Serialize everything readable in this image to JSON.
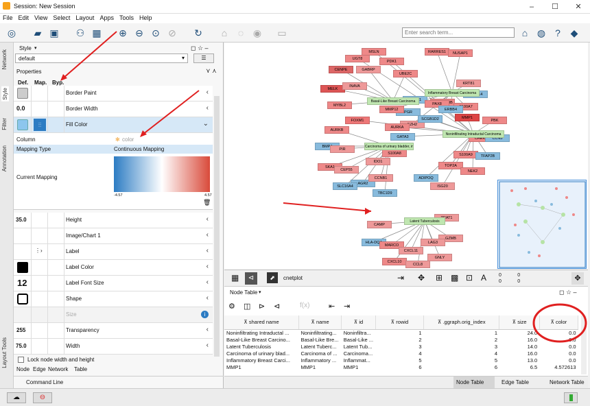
{
  "window": {
    "title": "Session: New Session"
  },
  "menu": [
    "File",
    "Edit",
    "View",
    "Select",
    "Layout",
    "Apps",
    "Tools",
    "Help"
  ],
  "search": {
    "placeholder": "Enter search term..."
  },
  "sidetabs": [
    "Network",
    "Style",
    "Filter",
    "Annotation",
    "Layout Tools"
  ],
  "style_panel": {
    "header": "Style",
    "style_select": "default",
    "properties_label": "Properties",
    "col_def": "Def.",
    "col_map": "Map.",
    "col_byp": "Byp.",
    "props": [
      {
        "label": "Border Paint",
        "def": ""
      },
      {
        "label": "Border Width",
        "def": "0.0"
      },
      {
        "label": "Fill Color",
        "def": ""
      }
    ],
    "mapping": {
      "column_label": "Column",
      "column_value": "color",
      "type_label": "Mapping Type",
      "type_value": "Continuous Mapping",
      "current_label": "Current Mapping",
      "min": "-4.57",
      "max": "4.57"
    },
    "props2": [
      {
        "label": "Height",
        "def": "35.0"
      },
      {
        "label": "Image/Chart 1",
        "def": ""
      },
      {
        "label": "Label",
        "def": ""
      },
      {
        "label": "Label Color",
        "def": ""
      },
      {
        "label": "Label Font Size",
        "def": "12"
      },
      {
        "label": "Shape",
        "def": ""
      },
      {
        "label": "Size",
        "def": ""
      },
      {
        "label": "Transparency",
        "def": "255"
      },
      {
        "label": "Width",
        "def": "75.0"
      }
    ],
    "lock_label": "Lock node width and height",
    "tabs": [
      "Node",
      "Edge",
      "Network",
      "Table"
    ]
  },
  "network": {
    "nodes": [
      {
        "t": "RARRES1",
        "c": "#e88"
      },
      {
        "t": "NUSAP1",
        "c": "#e88"
      },
      {
        "t": "MSLN",
        "c": "#e88"
      },
      {
        "t": "UGT8",
        "c": "#e88"
      },
      {
        "t": "PDK1",
        "c": "#e88"
      },
      {
        "t": "CENPE",
        "c": "#d66"
      },
      {
        "t": "GABRP",
        "c": "#e99"
      },
      {
        "t": "UBE2C",
        "c": "#e88"
      },
      {
        "t": "KRT81",
        "c": "#e99"
      },
      {
        "t": "MELK",
        "c": "#d55"
      },
      {
        "t": "INAVA",
        "c": "#e99"
      },
      {
        "t": "CXCL14",
        "c": "#8bd"
      },
      {
        "t": "APOBEC3B",
        "c": "#e88"
      },
      {
        "t": "MYBL2",
        "c": "#e88"
      },
      {
        "t": "FOXA1",
        "c": "#8bd"
      },
      {
        "t": "PAX8",
        "c": "#e88"
      },
      {
        "t": "S100A7",
        "c": "#e88"
      },
      {
        "t": "PGR",
        "c": "#8bd"
      },
      {
        "t": "ERBB4",
        "c": "#8bd"
      },
      {
        "t": "MMP12",
        "c": "#e88"
      },
      {
        "t": "MMP1",
        "c": "#d44"
      },
      {
        "t": "PBK",
        "c": "#e88"
      },
      {
        "t": "FOXM1",
        "c": "#e77"
      },
      {
        "t": "EZH2",
        "c": "#e99"
      },
      {
        "t": "SCGB1D2",
        "c": "#8bd"
      },
      {
        "t": "AURKA",
        "c": "#e88"
      },
      {
        "t": "CHEK1",
        "c": "#e88"
      },
      {
        "t": "CCN5",
        "c": "#8bd"
      },
      {
        "t": "AURKB",
        "c": "#e88"
      },
      {
        "t": "GATA3",
        "c": "#8bd"
      },
      {
        "t": "BMP4",
        "c": "#8bd"
      },
      {
        "t": "PIR",
        "c": "#e99"
      },
      {
        "t": "S100A8",
        "c": "#e88"
      },
      {
        "t": "S100A9",
        "c": "#e88"
      },
      {
        "t": "TFAP2B",
        "c": "#8bd"
      },
      {
        "t": "IDO1",
        "c": "#e99"
      },
      {
        "t": "SKA1",
        "c": "#e88"
      },
      {
        "t": "CEP55",
        "c": "#e99"
      },
      {
        "t": "TOP2A",
        "c": "#e88"
      },
      {
        "t": "NEK2",
        "c": "#e88"
      },
      {
        "t": "AGR2",
        "c": "#8bd"
      },
      {
        "t": "CCNB1",
        "c": "#e99"
      },
      {
        "t": "SLC16A4",
        "c": "#8bd"
      },
      {
        "t": "ADIPOQ",
        "c": "#8bd"
      },
      {
        "t": "ISG20",
        "c": "#e99"
      },
      {
        "t": "TBC1D9",
        "c": "#8bd"
      },
      {
        "t": "TRAT1",
        "c": "#e99"
      },
      {
        "t": "CAMP",
        "c": "#e99"
      },
      {
        "t": "GZMB",
        "c": "#e99"
      },
      {
        "t": "HLA-DQA",
        "c": "#8bd"
      },
      {
        "t": "MARCO",
        "c": "#e88"
      },
      {
        "t": "LAG3",
        "c": "#e99"
      },
      {
        "t": "CXCL11",
        "c": "#e99"
      },
      {
        "t": "GNLY",
        "c": "#e99"
      },
      {
        "t": "CXCL10",
        "c": "#e88"
      },
      {
        "t": "CCL8",
        "c": "#e99"
      }
    ],
    "hubs": [
      {
        "t": "Inflammatory Breast Carcinoma"
      },
      {
        "t": "Basal-Like Breast Carcinoma"
      },
      {
        "t": "Noninfiltrating Intraductal Carcinoma"
      },
      {
        "t": "Carcinoma of urinary bladder, invasive"
      },
      {
        "t": "Latent Tuberculosis"
      }
    ],
    "name_label": "cnetplot",
    "mini_vals": [
      "0",
      "0",
      "0",
      "0"
    ]
  },
  "node_table": {
    "header": "Node Table",
    "columns": [
      "shared name",
      "name",
      "id",
      "rowid",
      ".ggraph.orig_index",
      "size",
      "color"
    ],
    "rows": [
      [
        "Noninfiltrating Intraductal ...",
        "Noninfiltrating...",
        "Noninfiltra...",
        "1",
        "1",
        "24.0",
        "0.0"
      ],
      [
        "Basal-Like Breast Carcino...",
        "Basal-Like Bre...",
        "Basal-Like ...",
        "2",
        "2",
        "16.0",
        "0.0"
      ],
      [
        "Latent Tuberculosis",
        "Latent Tuberc...",
        "Latent Tub...",
        "3",
        "3",
        "14.0",
        "0.0"
      ],
      [
        "Carcinoma of urinary blad...",
        "Carcinoma of ...",
        "Carcinoma...",
        "4",
        "4",
        "16.0",
        "0.0"
      ],
      [
        "Inflammatory Breast Carci...",
        "Inflammatory ...",
        "Inflammat...",
        "5",
        "5",
        "13.0",
        "0.0"
      ],
      [
        "MMP1",
        "MMP1",
        "MMP1",
        "6",
        "6",
        "6.5",
        "4.572613"
      ]
    ],
    "tabs": [
      "Node Table",
      "Edge Table",
      "Network Table"
    ]
  },
  "command_line": "Command Line"
}
